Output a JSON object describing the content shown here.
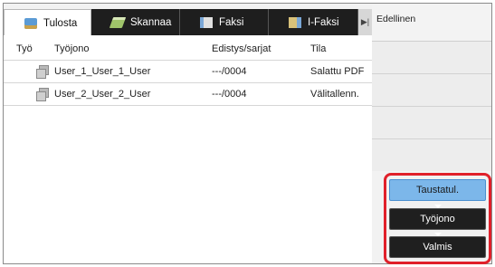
{
  "tabs": [
    {
      "label": "Tulosta",
      "icon": "print-icon",
      "active": true
    },
    {
      "label": "Skannaa",
      "icon": "scan-icon",
      "active": false
    },
    {
      "label": "Faksi",
      "icon": "fax-icon",
      "active": false
    },
    {
      "label": "I-Faksi",
      "icon": "internet-fax-icon",
      "active": false
    }
  ],
  "table": {
    "headers": {
      "type": "Työ",
      "queue": "Työjono",
      "progress": "Edistys/sarjat",
      "status": "Tila"
    },
    "rows": [
      {
        "name": "User_1_User_1_User",
        "progress": "---/0004",
        "status": "Salattu PDF"
      },
      {
        "name": "User_2_User_2_User",
        "progress": "---/0004",
        "status": "Välitallenn."
      }
    ]
  },
  "side": {
    "previous_label": "Edellinen"
  },
  "status_buttons": [
    {
      "label": "Taustatul.",
      "active": true
    },
    {
      "label": "Työjono",
      "active": false
    },
    {
      "label": "Valmis",
      "active": false
    }
  ],
  "colors": {
    "accent": "#7cb7ea",
    "highlight_border": "#e0202a",
    "tab_bar": "#1e1e1e"
  }
}
